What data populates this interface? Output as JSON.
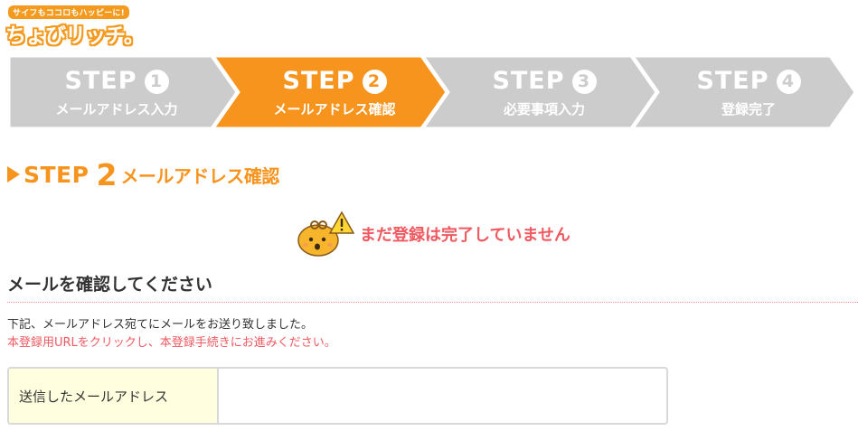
{
  "logo": {
    "tagline": "サイフもココロもハッピーに!",
    "name": "ちょびリッチ。"
  },
  "colors": {
    "active_step": "#f7941d",
    "inactive_step": "#cccccc",
    "alert": "#ef5a61",
    "label_bg": "#ffffe0"
  },
  "steps": [
    {
      "title": "STEP",
      "number": "1",
      "label": "メールアドレス入力",
      "state": "done"
    },
    {
      "title": "STEP",
      "number": "2",
      "label": "メールアドレス確認",
      "state": "active"
    },
    {
      "title": "STEP",
      "number": "3",
      "label": "必要事項入力",
      "state": "pending"
    },
    {
      "title": "STEP",
      "number": "4",
      "label": "登録完了",
      "state": "pending"
    }
  ],
  "section": {
    "step_word": "STEP",
    "step_number": "2",
    "title": "メールアドレス確認"
  },
  "notice": {
    "icon": "mascot-warning-icon",
    "text": "まだ登録は完了していません"
  },
  "confirm": {
    "heading": "メールを確認してください",
    "line1": "下記、メールアドレス宛てにメールをお送り致しました。",
    "line2": "本登録用URLをクリックし、本登録手続きにお進みください。"
  },
  "email": {
    "label": "送信したメールアドレス",
    "value": ""
  }
}
